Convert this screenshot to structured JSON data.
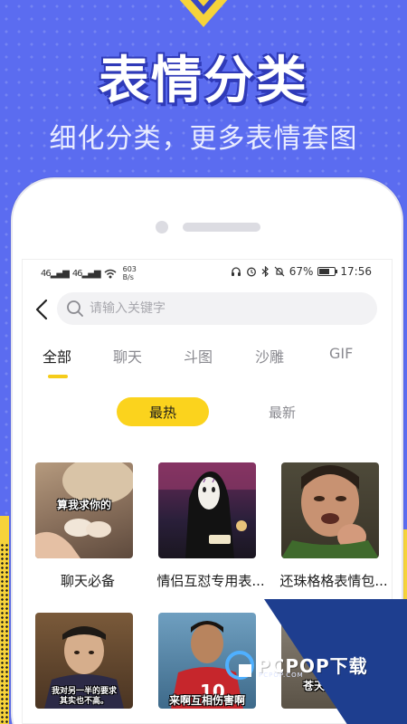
{
  "hero": {
    "title": "表情分类",
    "subtitle": "细化分类，更多表情套图"
  },
  "status_bar": {
    "signal_1": "46",
    "signal_2": "46",
    "net_speed_value": "603",
    "net_speed_unit": "B/s",
    "battery_text": "67%",
    "battery_level": 0.67,
    "time": "17:56"
  },
  "search": {
    "placeholder": "请输入关键字"
  },
  "tabs": [
    {
      "label": "全部",
      "active": true
    },
    {
      "label": "聊天",
      "active": false
    },
    {
      "label": "斗图",
      "active": false
    },
    {
      "label": "沙雕",
      "active": false
    },
    {
      "label": "GIF",
      "active": false
    }
  ],
  "sort": {
    "hot_label": "最热",
    "new_label": "最新",
    "selected": "最热"
  },
  "cards": [
    {
      "label": "聊天必备",
      "caption": "算我求你的"
    },
    {
      "label": "情侣互怼专用表...",
      "caption": ""
    },
    {
      "label": "还珠格格表情包...",
      "caption": ""
    },
    {
      "label": "",
      "caption": "我对另一半的要求\n其实也不高。"
    },
    {
      "label": "",
      "caption": "来啊互相伤害啊"
    },
    {
      "label": "",
      "caption": "苍天呐！我"
    }
  ],
  "watermark": {
    "brand": "PCPOP下载",
    "sub": "PCPOP.COM"
  },
  "colors": {
    "background": "#5b6cf0",
    "accent_yellow": "#fbd31d",
    "watermark_blue": "#1e3e8f"
  }
}
